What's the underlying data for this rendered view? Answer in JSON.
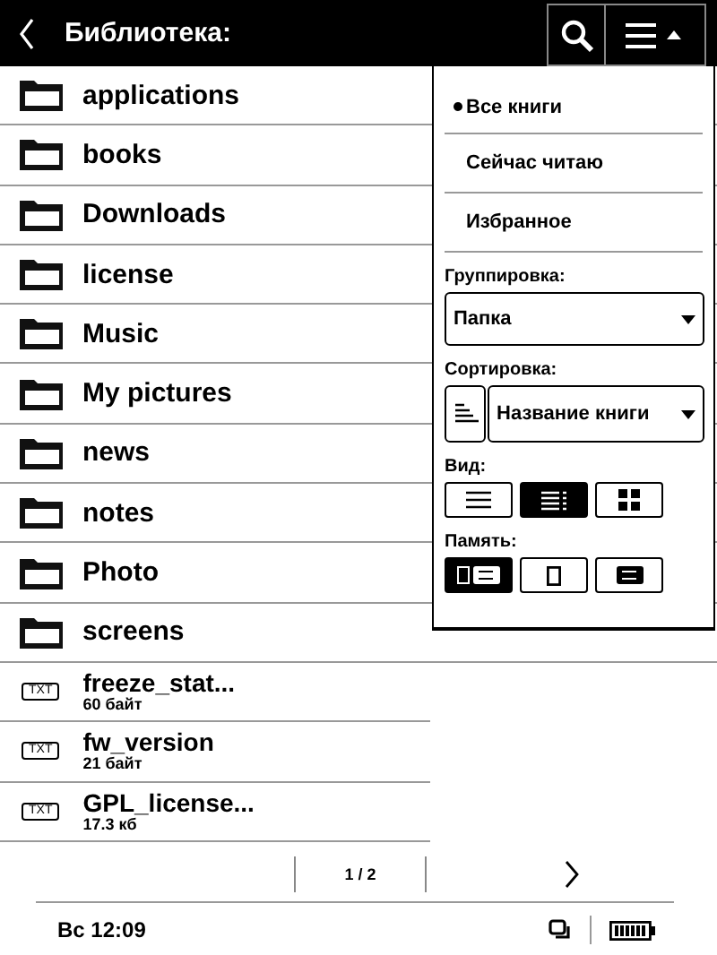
{
  "header": {
    "title": "Библиотека:"
  },
  "items": [
    {
      "kind": "folder",
      "name": "applications"
    },
    {
      "kind": "folder",
      "name": "books"
    },
    {
      "kind": "folder",
      "name": "Downloads"
    },
    {
      "kind": "folder",
      "name": "license"
    },
    {
      "kind": "folder",
      "name": "Music"
    },
    {
      "kind": "folder",
      "name": "My pictures"
    },
    {
      "kind": "folder",
      "name": "news"
    },
    {
      "kind": "folder",
      "name": "notes"
    },
    {
      "kind": "folder",
      "name": "Photo"
    },
    {
      "kind": "folder",
      "name": "screens"
    },
    {
      "kind": "file",
      "badge": "TXT",
      "name": "freeze_stat...",
      "size": "60 байт"
    },
    {
      "kind": "file",
      "badge": "TXT",
      "name": "fw_version",
      "size": "21 байт"
    },
    {
      "kind": "file",
      "badge": "TXT",
      "name": "GPL_license...",
      "size": "17.3 кб"
    }
  ],
  "menu": {
    "filters": [
      {
        "label": "Все книги",
        "selected": true
      },
      {
        "label": "Сейчас читаю",
        "selected": false
      },
      {
        "label": "Избранное",
        "selected": false
      }
    ],
    "grouping": {
      "label": "Группировка:",
      "value": "Папка"
    },
    "sorting": {
      "label": "Сортировка:",
      "value": "Название книги"
    },
    "view": {
      "label": "Вид:",
      "options": [
        {
          "kind": "list",
          "selected": false
        },
        {
          "kind": "detailed",
          "selected": true
        },
        {
          "kind": "grid",
          "selected": false
        }
      ]
    },
    "memory": {
      "label": "Память:",
      "options": [
        {
          "kind": "both",
          "selected": true
        },
        {
          "kind": "internal",
          "selected": false
        },
        {
          "kind": "sd",
          "selected": false
        }
      ]
    }
  },
  "pager": {
    "page": "1 / 2"
  },
  "status": {
    "time": "Вс 12:09"
  }
}
